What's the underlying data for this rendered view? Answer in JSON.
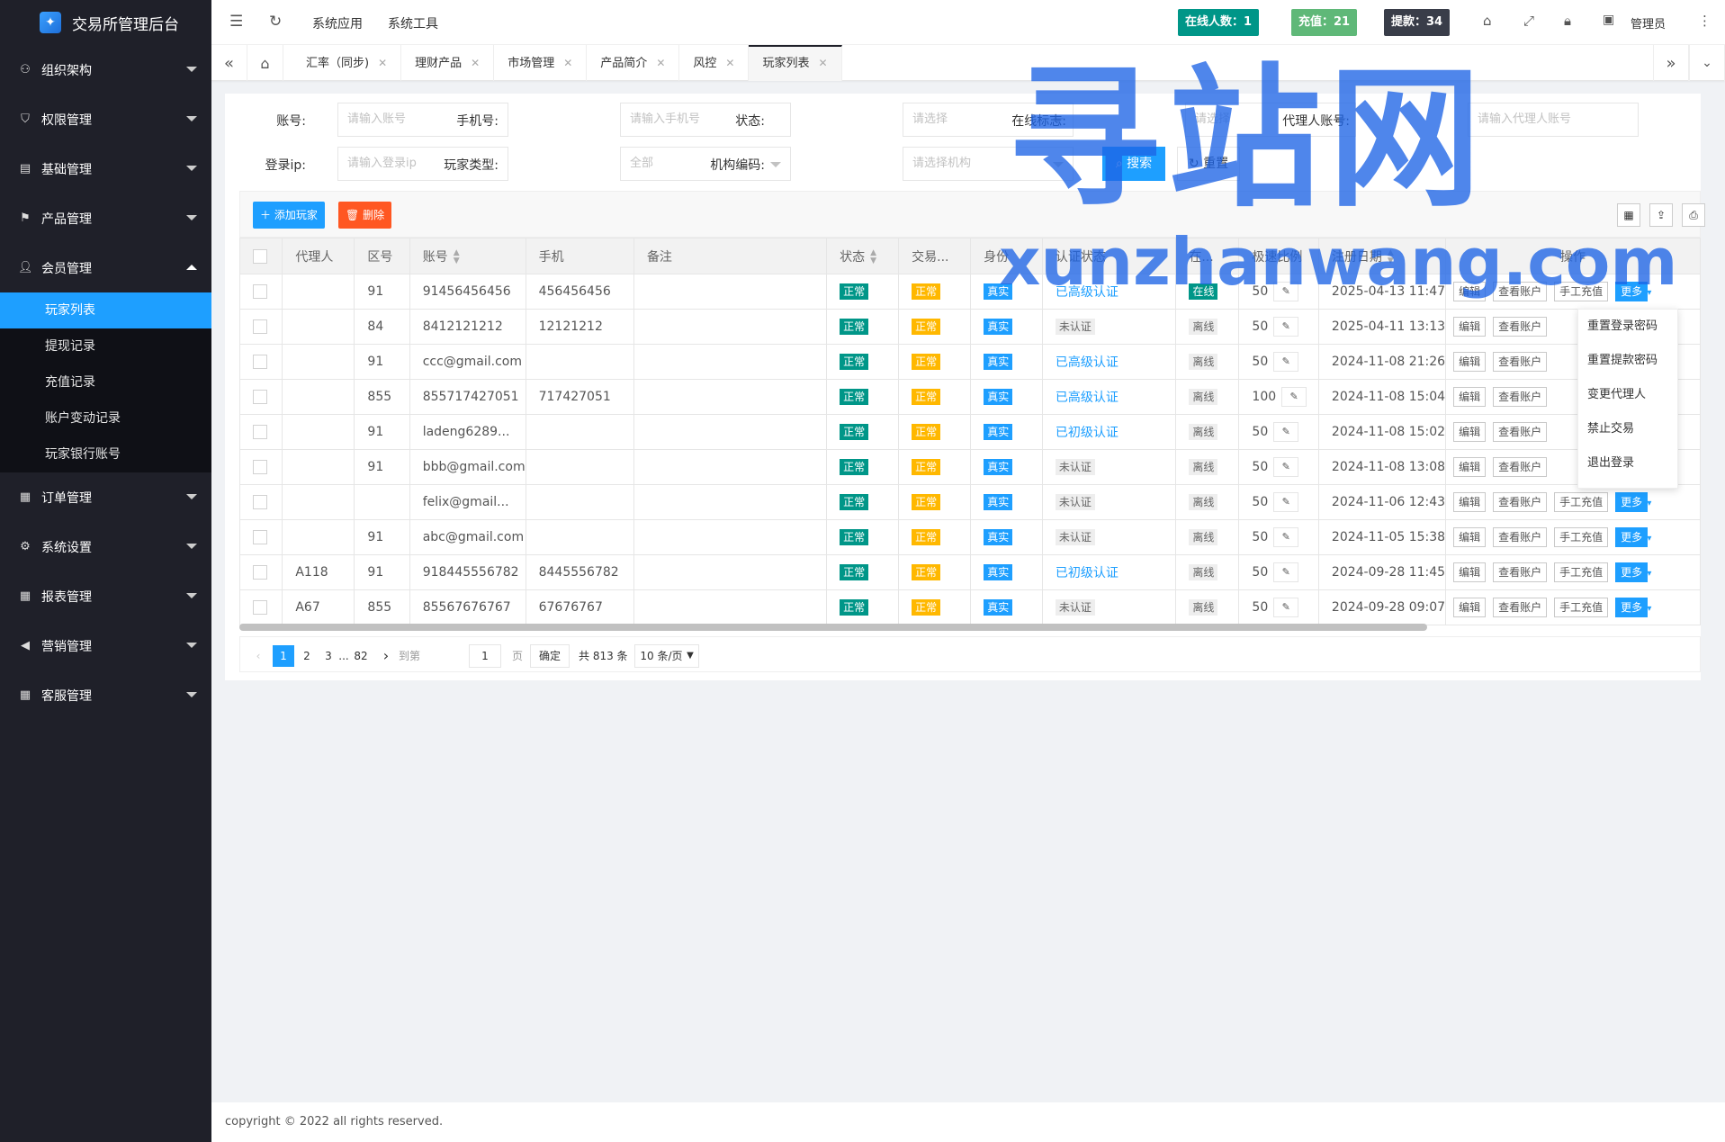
{
  "app": {
    "title": "交易所管理后台"
  },
  "sidebar": {
    "groups": [
      {
        "label": "组织架构",
        "icon": "org-icon"
      },
      {
        "label": "权限管理",
        "icon": "shield-icon"
      },
      {
        "label": "基础管理",
        "icon": "base-icon"
      },
      {
        "label": "产品管理",
        "icon": "flag-icon"
      },
      {
        "label": "会员管理",
        "icon": "user-icon"
      },
      {
        "label": "订单管理",
        "icon": "order-icon"
      },
      {
        "label": "系统设置",
        "icon": "gear-icon"
      },
      {
        "label": "报表管理",
        "icon": "report-icon"
      },
      {
        "label": "营销管理",
        "icon": "speaker-icon"
      },
      {
        "label": "客服管理",
        "icon": "service-icon"
      }
    ],
    "member_sub": [
      "玩家列表",
      "提现记录",
      "充值记录",
      "账户变动记录",
      "玩家银行账号"
    ]
  },
  "topbar": {
    "links": [
      "系统应用",
      "系统工具"
    ],
    "online": "在线人数：1",
    "recharge": "充值：21",
    "withdraw": "提款：34",
    "user": "管理员",
    "colors": {
      "online": "#009688",
      "recharge": "#5fb878",
      "withdraw": "#393d49"
    }
  },
  "tabs": [
    "汇率（同步)",
    "理财产品",
    "市场管理",
    "产品简介",
    "风控",
    "玩家列表"
  ],
  "filters": {
    "account_label": "账号:",
    "account_ph": "请输入账号",
    "phone_label": "手机号:",
    "phone_ph": "请输入手机号",
    "status_label": "状态:",
    "status_ph": "请选择",
    "online_label": "在线标志:",
    "online_ph": "请选择",
    "agent_label": "代理人账号:",
    "agent_ph": "请输入代理人账号",
    "ip_label": "登录ip:",
    "ip_ph": "请输入登录ip",
    "type_label": "玩家类型:",
    "type_ph": "全部",
    "org_label": "机构编码:",
    "org_ph": "请选择机构",
    "search": "搜索",
    "reset": "重置"
  },
  "toolbar": {
    "add": "添加玩家",
    "delete": "删除"
  },
  "table": {
    "headers": [
      "代理人",
      "区号",
      "账号",
      "手机",
      "备注",
      "状态",
      "交易...",
      "身份",
      "认证状态",
      "在...",
      "极速比例",
      "注册日期",
      "操作"
    ],
    "rows": [
      {
        "agent": "",
        "area": "91",
        "account": "91456456456",
        "phone": "456456456",
        "note": "",
        "status": "正常",
        "trade": "正常",
        "id": "真实",
        "auth": "已高级认证",
        "online": "在线",
        "ratio": "50",
        "date": "2025-04-13 11:47",
        "last": [
          "手工充值",
          "更多"
        ]
      },
      {
        "agent": "",
        "area": "84",
        "account": "8412121212",
        "phone": "12121212",
        "note": "",
        "status": "正常",
        "trade": "正常",
        "id": "真实",
        "auth": "未认证",
        "online": "离线",
        "ratio": "50",
        "date": "2025-04-11 13:13",
        "last": []
      },
      {
        "agent": "",
        "area": "91",
        "account": "ccc@gmail.com",
        "phone": "",
        "note": "",
        "status": "正常",
        "trade": "正常",
        "id": "真实",
        "auth": "已高级认证",
        "online": "离线",
        "ratio": "50",
        "date": "2024-11-08 21:26",
        "last": []
      },
      {
        "agent": "",
        "area": "855",
        "account": "855717427051",
        "phone": "717427051",
        "note": "",
        "status": "正常",
        "trade": "正常",
        "id": "真实",
        "auth": "已高级认证",
        "online": "离线",
        "ratio": "100",
        "date": "2024-11-08 15:04",
        "last": []
      },
      {
        "agent": "",
        "area": "91",
        "account": "ladeng6289...",
        "phone": "",
        "note": "",
        "status": "正常",
        "trade": "正常",
        "id": "真实",
        "auth": "已初级认证",
        "online": "离线",
        "ratio": "50",
        "date": "2024-11-08 15:02",
        "last": []
      },
      {
        "agent": "",
        "area": "91",
        "account": "bbb@gmail.com",
        "phone": "",
        "note": "",
        "status": "正常",
        "trade": "正常",
        "id": "真实",
        "auth": "未认证",
        "online": "离线",
        "ratio": "50",
        "date": "2024-11-08 13:08",
        "last": []
      },
      {
        "agent": "",
        "area": "",
        "account": "felix@gmail...",
        "phone": "",
        "note": "",
        "status": "正常",
        "trade": "正常",
        "id": "真实",
        "auth": "未认证",
        "online": "离线",
        "ratio": "50",
        "date": "2024-11-06 12:43",
        "last": [
          "手工充值",
          "更多"
        ]
      },
      {
        "agent": "",
        "area": "91",
        "account": "abc@gmail.com",
        "phone": "",
        "note": "",
        "status": "正常",
        "trade": "正常",
        "id": "真实",
        "auth": "未认证",
        "online": "离线",
        "ratio": "50",
        "date": "2024-11-05 15:38",
        "last": [
          "手工充值",
          "更多"
        ]
      },
      {
        "agent": "A118",
        "area": "91",
        "account": "918445556782",
        "phone": "8445556782",
        "note": "",
        "status": "正常",
        "trade": "正常",
        "id": "真实",
        "auth": "已初级认证",
        "online": "离线",
        "ratio": "50",
        "date": "2024-09-28 11:45",
        "last": [
          "手工充值",
          "更多"
        ]
      },
      {
        "agent": "A67",
        "area": "855",
        "account": "85567676767",
        "phone": "67676767",
        "note": "",
        "status": "正常",
        "trade": "正常",
        "id": "真实",
        "auth": "未认证",
        "online": "离线",
        "ratio": "50",
        "date": "2024-09-28 09:07",
        "last": [
          "手工充值",
          "更多"
        ]
      }
    ],
    "op_edit": "编辑",
    "op_view": "查看账户"
  },
  "dropdown": [
    "重置登录密码",
    "重置提款密码",
    "变更代理人",
    "禁止交易",
    "退出登录"
  ],
  "pager": {
    "pages": [
      "1",
      "2",
      "3",
      "...",
      "82"
    ],
    "goto": "到第",
    "page_val": "1",
    "page_unit": "页",
    "confirm": "确定",
    "total": "共 813 条",
    "per_page": "10 条/页"
  },
  "watermark": {
    "line1": "寻站网",
    "line2": "xunzhanwang.com"
  },
  "footer": "copyright © 2022 all rights reserved."
}
